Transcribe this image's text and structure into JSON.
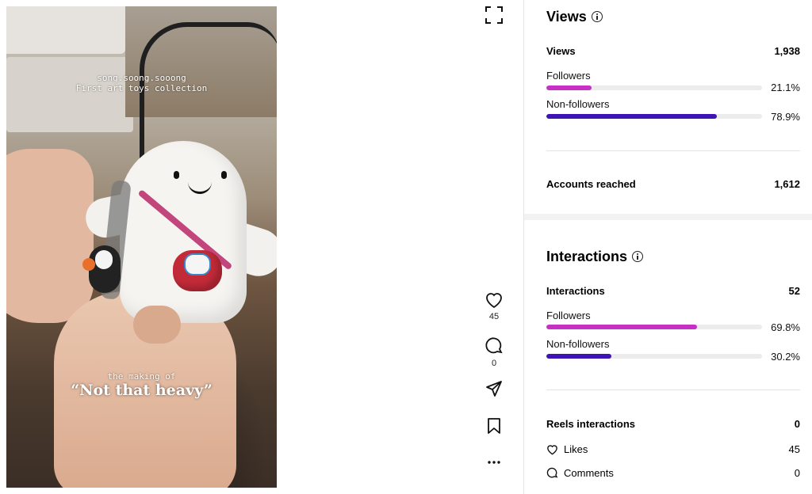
{
  "video": {
    "caption_line1": "song.soong.sooong",
    "caption_line2": "First art toys collection",
    "caption_making": "the making of",
    "caption_title": "“Not that heavy”"
  },
  "actions": {
    "likes_count": "45",
    "comments_count": "0"
  },
  "views": {
    "heading": "Views",
    "total_label": "Views",
    "total_value": "1,938",
    "followers_label": "Followers",
    "followers_pct": "21.1%",
    "followers_fraction": 0.211,
    "nonfollowers_label": "Non-followers",
    "nonfollowers_pct": "78.9%",
    "nonfollowers_fraction": 0.789,
    "reached_label": "Accounts reached",
    "reached_value": "1,612"
  },
  "interactions": {
    "heading": "Interactions",
    "total_label": "Interactions",
    "total_value": "52",
    "followers_label": "Followers",
    "followers_pct": "69.8%",
    "followers_fraction": 0.698,
    "nonfollowers_label": "Non-followers",
    "nonfollowers_pct": "30.2%",
    "nonfollowers_fraction": 0.302,
    "reels_label": "Reels interactions",
    "reels_value": "0",
    "likes_label": "Likes",
    "likes_value": "45",
    "comments_label": "Comments",
    "comments_value": "0"
  },
  "colors": {
    "followers_bar": "#c630c5",
    "nonfollowers_bar": "#3e14b4"
  },
  "icons": [
    "fullscreen-icon",
    "heart-icon",
    "comment-icon",
    "share-icon",
    "bookmark-icon",
    "more-icon",
    "info-icon"
  ]
}
